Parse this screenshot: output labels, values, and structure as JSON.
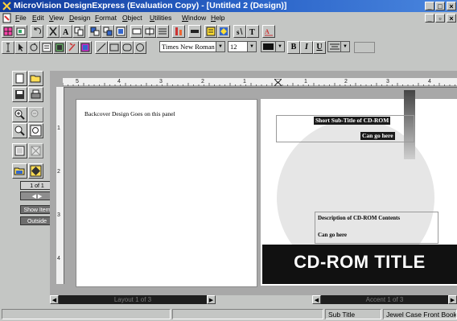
{
  "window": {
    "title": "MicroVision DesignExpress (Evaluation Copy) - [Untitled 2 (Design)]",
    "controls": [
      "_",
      "□",
      "×"
    ],
    "doc_controls": [
      "_",
      "▫",
      "×"
    ]
  },
  "menu": [
    {
      "label": "File",
      "u": "F",
      "rest": "ile"
    },
    {
      "label": "Edit",
      "u": "E",
      "rest": "dit"
    },
    {
      "label": "View",
      "u": "V",
      "rest": "iew"
    },
    {
      "label": "Design",
      "u": "D",
      "rest": "esign"
    },
    {
      "label": "Format",
      "u": "F",
      "rest": "ormat"
    },
    {
      "label": "Object",
      "u": "O",
      "rest": "bject"
    },
    {
      "label": "Utilities",
      "u": "U",
      "rest": "tilities"
    },
    {
      "label": "Window",
      "u": "W",
      "rest": "indow"
    },
    {
      "label": "Help",
      "u": "H",
      "rest": "elp"
    }
  ],
  "format_bar": {
    "font": "Times New Roman",
    "size": "12",
    "bold": "B",
    "italic": "I",
    "underline": "U"
  },
  "palette": {
    "page_indicator": "1 of 1",
    "show_item": "Show Item",
    "outside": "Outside"
  },
  "ruler": {
    "h_labels": [
      "5",
      "4",
      "3",
      "2",
      "1",
      "1",
      "2",
      "3",
      "4"
    ],
    "v_labels": [
      "1",
      "2",
      "3",
      "4"
    ]
  },
  "document": {
    "back_text": "Backcover Design Goes on this panel",
    "short_subtitle": "Short Sub-Title of CD-ROM",
    "goes_here_1": "Can go here",
    "description": "Description of CD-ROM Contents",
    "goes_here_2": "Can go here",
    "cd_title": "CD-ROM TITLE"
  },
  "scroll": {
    "left_label": "Layout 1 of 3",
    "right_label": "Accent 1 of 3"
  },
  "status": {
    "cells": [
      "",
      "",
      "Sub Title",
      "Jewel Case Front Booklet"
    ]
  },
  "colors": {
    "titlebar": "#1a4aa8",
    "face": "#c4c6c4",
    "accent_dark": "#111111"
  }
}
